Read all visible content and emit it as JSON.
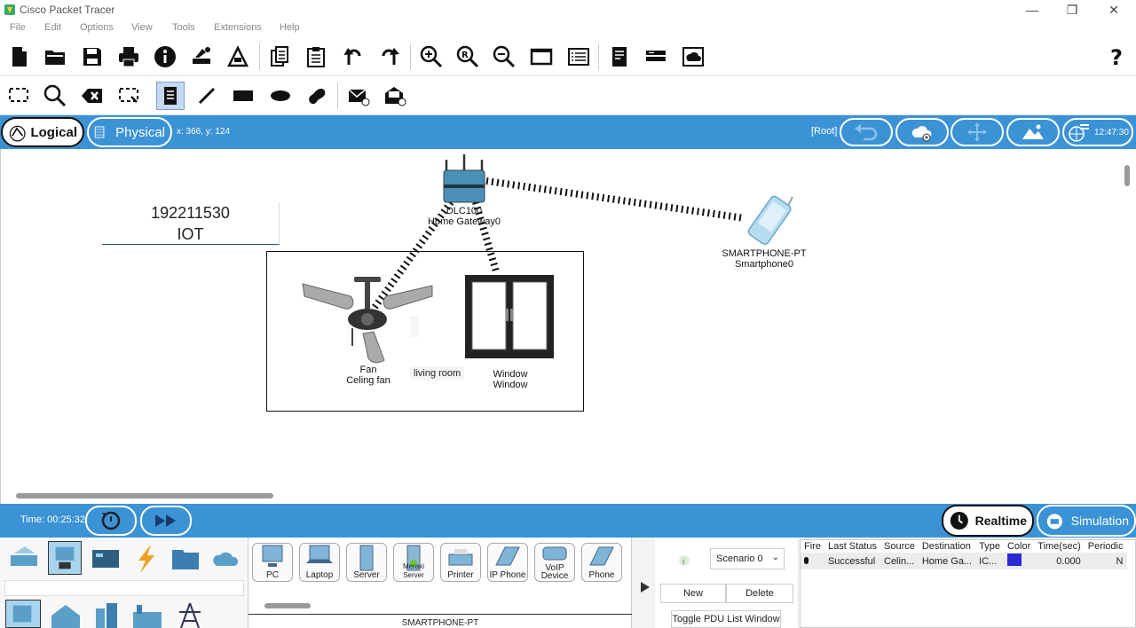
{
  "app": {
    "title": "Cisco Packet Tracer"
  },
  "menu": [
    "File",
    "Edit",
    "Options",
    "View",
    "Tools",
    "Extensions",
    "Help"
  ],
  "modebar": {
    "logical": "Logical",
    "physical": "Physical",
    "coords": "x: 366, y: 124",
    "root": "[Root]",
    "clock": "12:47:30"
  },
  "canvas": {
    "note_line1": "192211530",
    "note_line2": "IOT",
    "gateway_model": "DLC100",
    "gateway_name": "Home Gateway0",
    "phone_model": "SMARTPHONE-PT",
    "phone_name": "Smartphone0",
    "fan_model": "Fan",
    "fan_name": "Celing fan",
    "window_model": "Window",
    "window_name": "Window",
    "room_label": "living room"
  },
  "timebar": {
    "time": "Time: 00:25:32",
    "realtime": "Realtime",
    "simulation": "Simulation"
  },
  "devices": [
    "PC",
    "Laptop",
    "Server",
    "Meraki Server",
    "Printer",
    "IP Phone",
    "VoIP Device",
    "Phone"
  ],
  "selected_device": "SMARTPHONE-PT",
  "scenario": {
    "selected": "Scenario 0",
    "new": "New",
    "delete": "Delete",
    "toggle": "Toggle PDU List Window"
  },
  "pdu_table": {
    "headers": [
      "Fire",
      "Last Status",
      "Source",
      "Destination",
      "Type",
      "Color",
      "Time(sec)",
      "Periodic"
    ],
    "rows": [
      {
        "fire": "",
        "status": "Successful",
        "source": "Celin...",
        "destination": "Home Ga...",
        "type": "IC...",
        "color": "#2b2bd6",
        "time": "0.000",
        "periodic": "N"
      }
    ]
  }
}
